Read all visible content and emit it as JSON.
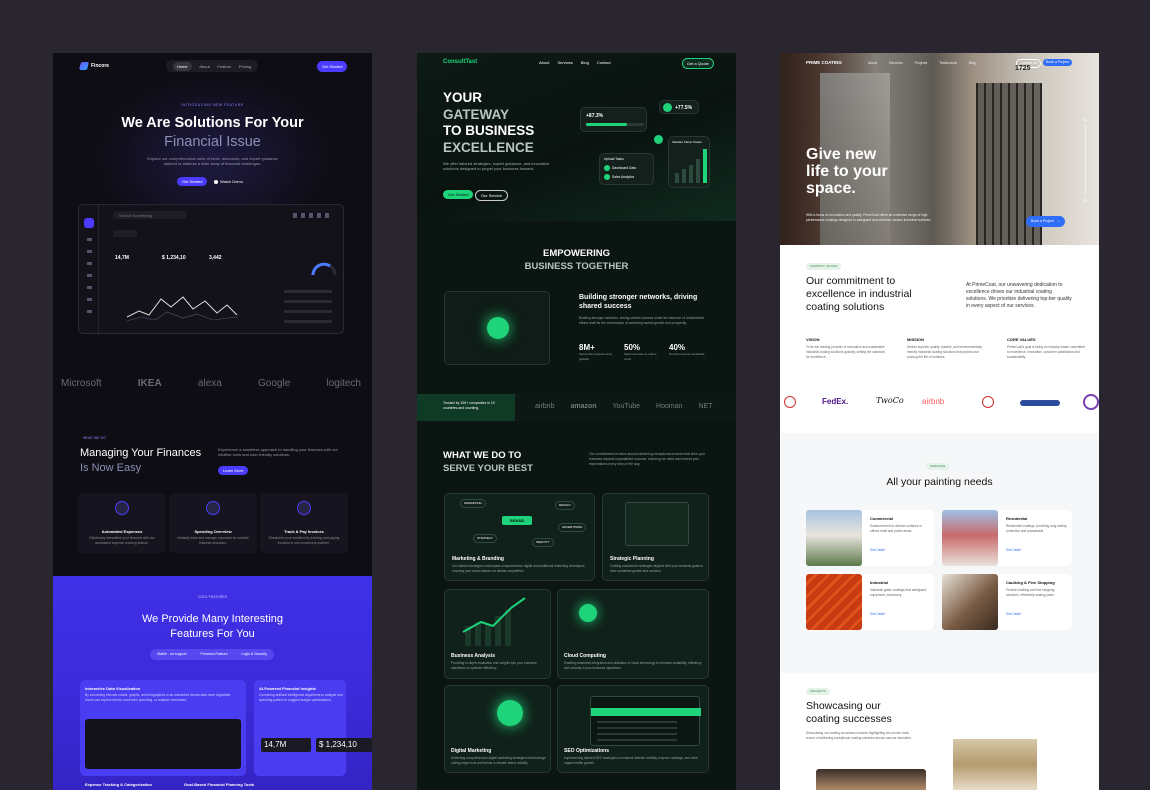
{
  "p1": {
    "brand": "Fincore",
    "nav": [
      "Home",
      "About",
      "Feature",
      "Pricing"
    ],
    "cta": "Get Started",
    "eyebrow": "INTRODUCING NEW FEATURE",
    "h1a": "We Are Solutions For Your",
    "h1b": "Financial Issue",
    "sub": "Explore our comprehensive suite of tools, resources, and expert guidance tailored to address a wide array of financial challenges.",
    "btn1": "Get Started",
    "btn2": "Watch Demo",
    "search": "Search Something",
    "stat1": "14,7M",
    "stat2": "$ 1,234,10",
    "stat3": "3,442",
    "logos": [
      "Microsoft",
      "IKEA",
      "alexa",
      "Google",
      "logitech"
    ],
    "s2eyebrow": "WHAT WE DO",
    "s2h_a": "Managing Your Finances",
    "s2h_b": "Is Now Easy",
    "s2p": "Experience a seamless approach to handling your finances with our intuitive tools and user-friendly solutions.",
    "s2btn": "Learn More",
    "features": [
      {
        "t": "Automated Expenses",
        "d": "Effortlessly streamline your finances with our automated expense tracking feature."
      },
      {
        "t": "Spending Overview",
        "d": "Instantly track and manage expenses for smarter financial decisions."
      },
      {
        "t": "Track & Pay Invoices",
        "d": "Streamline your workflow by tracking and paying invoices in one convenient platform."
      }
    ],
    "s3eyebrow": "COOL FEATURES",
    "s3h_a": "We Provide Many Interesting",
    "s3h_b": "Features For You",
    "tabs": [
      "Stable - on support",
      "Premium Feature",
      "Login & Security"
    ],
    "c1t": "Interactive Data Visualization",
    "c1d": "By converting intricate charts, graphs, and infographics in an interactive format data more digestible. Users can explore trends, track their spending, or analyze investment.",
    "c2t": "AI-Powered Financial Insights",
    "c2d": "Combining artificial intelligence algorithms to analyze and spending pattern to suggest budget optimizations.",
    "c1stat": "14,7M",
    "c2stat": "$ 1,234,10",
    "c3t": "Expense Tracking & Categorization",
    "c4t": "Goal-Based Financial Planning Tools"
  },
  "p2": {
    "brand": "ConsultTast",
    "nav": [
      "About",
      "Services",
      "Blog",
      "Contact"
    ],
    "cta": "Get a Quote",
    "h1": [
      "YOUR",
      "GATEWAY",
      "TO BUSINESS",
      "EXCELLENCE"
    ],
    "sub": "We offer tailored strategies, expert guidance, and innovative solutions designed to propel your business forward.",
    "btn1": "Get Started",
    "btn2": "Our Service",
    "m1": "+87.3%",
    "m2": "+77.5%",
    "upload": "Upload Tasks",
    "tasks": [
      "Dashboard Data",
      "Sales Analytics"
    ],
    "chartlbl": "Statistics Status Tracker",
    "h2": [
      "EMPOWERING",
      "BUSINESS TOGETHER"
    ],
    "net_t": "Building stronger networks, driving shared success",
    "net_d": "Building stronger networks, driving shared success under the essence of collaborative efforts shall be the cornerstone of achieving mutual growth and prosperity.",
    "stats": [
      {
        "v": "8M+",
        "l": "Successful projects done globally"
      },
      {
        "v": "50%",
        "l": "Sales increase & reduce costs"
      },
      {
        "v": "40%",
        "l": "Growth revenue worldwide"
      }
    ],
    "trusted": "Trusted by 150+ companies in 10 countries and counting.",
    "logos": [
      "airbnb",
      "amazon",
      "YouTube",
      "Hooman",
      "NET"
    ],
    "h3": [
      "WHAT WE DO TO",
      "SERVE YOUR BEST"
    ],
    "h3p": "Our commitment revolves around delivering exceptional services that drive your business towards unparalleled success, ensuring we meet and exceed your expectations every step of the way.",
    "svc": [
      {
        "t": "Marketing & Branding",
        "d": "Our tailored strategies encompass comprehensive digital and traditional marketing techniques, ensuring your brand stands out amidst competition."
      },
      {
        "t": "Strategic Planning",
        "d": "Crafting customized strategies aligned with your business goals to drive sustained growth and success."
      },
      {
        "t": "Business Analysis",
        "d": "Providing in-depth evaluation and insights into your business operations to optimize efficiency."
      },
      {
        "t": "Cloud Computing",
        "d": "Enabling seamless integration and utilization of cloud technology to enhance scalability, efficiency, and security in your business operations."
      },
      {
        "t": "Digital Marketing",
        "d": "Delivering comprehensive digital marketing strategies that leverage cutting-edge tools and trends to elevate brand visibility."
      },
      {
        "t": "SEO Optimizations",
        "d": "Implementing tailored SEO strategies to enhance website visibility, improve rankings, and drive organic traffic growth."
      }
    ],
    "tags": [
      "MARKETING",
      "BRAND",
      "DESIGN",
      "ADVERTISING",
      "STRATEGY",
      "IDENTITY"
    ]
  },
  "p3": {
    "brand": "PRIME COATING",
    "nav": [
      "About",
      "Services",
      "Projects",
      "Testimonial",
      "Blog"
    ],
    "btn_contact": "Contact Us",
    "btn_book": "Book a Project",
    "house_no": "1725",
    "hero": [
      "Give new",
      "life to your",
      "space."
    ],
    "hero_p": "With a focus on innovation and quality, PrimeCoat offers an extensive range of high-performance coatings designed to safeguard and enhance various industrial surfaces.",
    "hero_btn": "Book a Project",
    "slide1": "01",
    "slide2": "03",
    "values_tag": "COMPANY VALUES",
    "values_h": [
      "Our commitment to",
      "excellence in industrial",
      "coating solutions"
    ],
    "values_p": "At PrimeCoat, our unwavering dedication to excellence drives our industrial coating solutions. We prioritize delivering top-tier quality in every aspect of our services.",
    "cols": [
      {
        "t": "VISION",
        "d": "To be the leading provider of innovative and sustainable industrial coating solutions globally, setting the standard for excellence."
      },
      {
        "t": "MISSION",
        "d": "Deliver superior quality, durable, and environmentally friendly industrial coating solutions that protect and prolong the life of surfaces."
      },
      {
        "t": "CORE VALUES",
        "d": "PrimeCoat's goal is being an industry leader committed to excellence, innovation, customer satisfaction and sustainability."
      }
    ],
    "logos": [
      "FedEx.",
      "TwoCo",
      "airbnb"
    ],
    "svc_tag": "SERVICES",
    "svc_h": "All your painting needs",
    "svc": [
      {
        "t": "Commercial",
        "d": "Enhancement for diverse surfaces in offices retail and public areas.",
        "l": "See Detail"
      },
      {
        "t": "Residential",
        "d": "Residential coatings, providing long-lasting protection and sustainable.",
        "l": "See Detail"
      },
      {
        "t": "Industrial",
        "d": "Industrial grade coatings that safeguard equipment, machinery.",
        "l": "See Detail"
      },
      {
        "t": "Caulking & Fine Stopping",
        "d": "Precise caulking and fine stopping solutions, effectively sealing joints.",
        "l": "See Detail"
      }
    ],
    "proj_tag": "PROJECTS",
    "proj_h": [
      "Showcasing our",
      "coating successes"
    ],
    "proj_p": "Showcasing our coating successes involves highlighting our proven track record of delivering exceptional coating solutions across various industries."
  },
  "colors": {
    "p1_accent": "#4b3bff",
    "p2_accent": "#1fd37a",
    "p3_accent": "#2f6df6"
  }
}
